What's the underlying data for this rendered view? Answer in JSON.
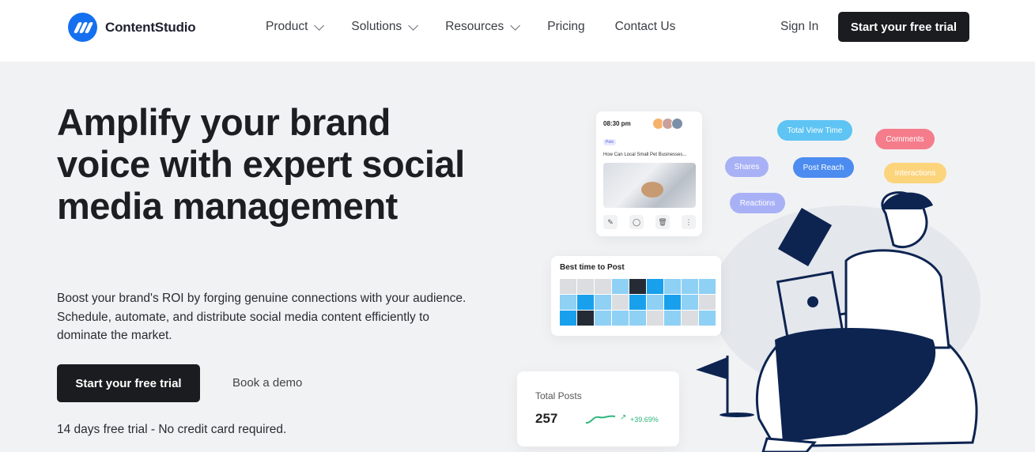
{
  "brand": {
    "name": "ContentStudio",
    "color": "#1570ef"
  },
  "nav": {
    "items": [
      {
        "label": "Product",
        "has_dropdown": true
      },
      {
        "label": "Solutions",
        "has_dropdown": true
      },
      {
        "label": "Resources",
        "has_dropdown": true
      },
      {
        "label": "Pricing",
        "has_dropdown": false
      },
      {
        "label": "Contact Us",
        "has_dropdown": false
      }
    ],
    "signin": "Sign In",
    "cta": "Start your free trial"
  },
  "hero": {
    "title": "Amplify your brand voice with expert social media management",
    "description": "Boost your brand's ROI by forging genuine connections with your audience. Schedule, automate, and distribute social media content efficiently to dominate the market.",
    "primary_cta": "Start your free trial",
    "secondary_cta": "Book a demo",
    "note": "14 days free trial - No credit card required."
  },
  "post_card": {
    "time": "08:30 pm",
    "tag": "Pets",
    "headline": "How Can Local Small Pet Businesses..."
  },
  "metric_pills": [
    {
      "label": "Total View Time",
      "color": "#5ec4f4"
    },
    {
      "label": "Comments",
      "color": "#f57c8b"
    },
    {
      "label": "Shares",
      "color": "#a9b1f6"
    },
    {
      "label": "Post Reach",
      "color": "#4c8cf0"
    },
    {
      "label": "Interactions",
      "color": "#fcd47c"
    },
    {
      "label": "Reactions",
      "color": "#a9b1f6"
    }
  ],
  "best_time": {
    "title": "Best time to Post",
    "colors": {
      "d": "#dcdde0",
      "l": "#8fd0f5",
      "m": "#18a0ec",
      "k": "#252b35"
    },
    "cells": [
      [
        "d",
        "d",
        "d",
        "l",
        "k",
        "m",
        "l",
        "l",
        "l"
      ],
      [
        "l",
        "m",
        "l",
        "d",
        "m",
        "l",
        "m",
        "l",
        "d"
      ],
      [
        "m",
        "k",
        "l",
        "l",
        "l",
        "d",
        "l",
        "d",
        "l"
      ]
    ]
  },
  "total_posts": {
    "label": "Total Posts",
    "value": "257",
    "growth": "+39.69%"
  }
}
